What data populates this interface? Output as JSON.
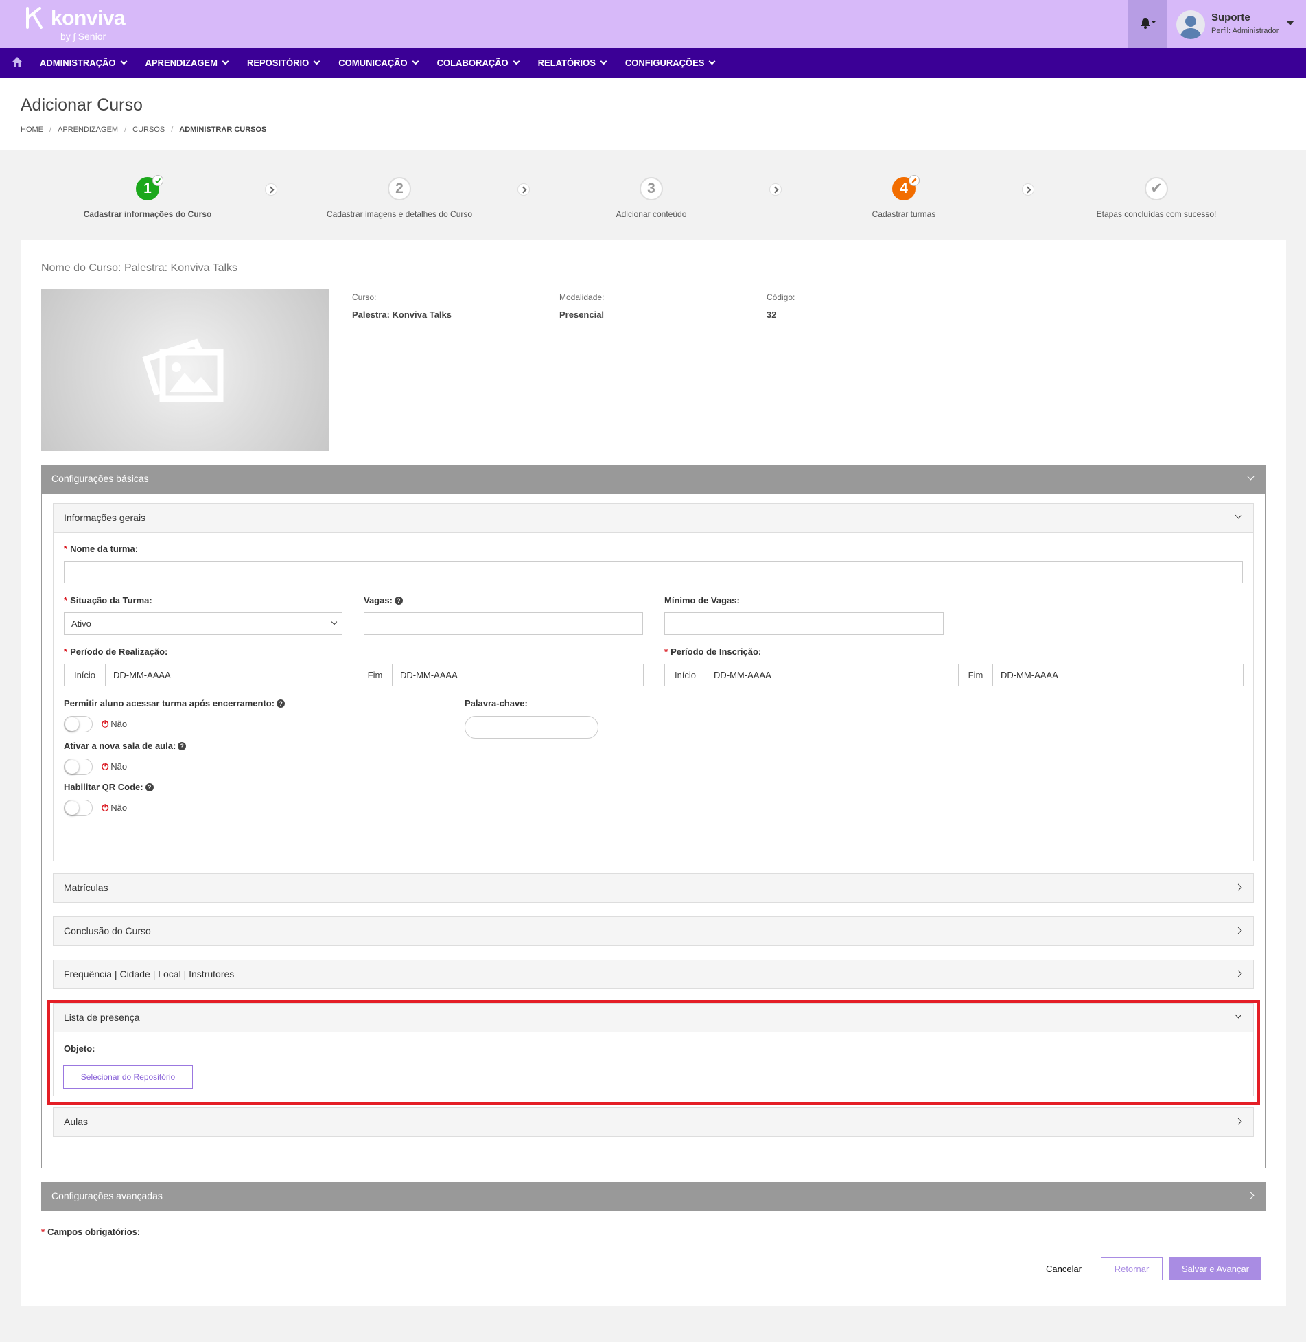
{
  "brand": {
    "logo_text": "konviva",
    "by_text": "by ʃ Senior"
  },
  "user": {
    "name": "Suporte",
    "role": "Perfil: Administrador"
  },
  "nav": {
    "items": [
      "ADMINISTRAÇÃO",
      "APRENDIZAGEM",
      "REPOSITÓRIO",
      "COMUNICAÇÃO",
      "COLABORAÇÃO",
      "RELATÓRIOS",
      "CONFIGURAÇÕES"
    ]
  },
  "page": {
    "title": "Adicionar Curso",
    "breadcrumb": [
      "HOME",
      "APRENDIZAGEM",
      "CURSOS",
      "ADMINISTRAR CURSOS"
    ]
  },
  "steps": [
    {
      "number": "1",
      "label": "Cadastrar informações do Curso",
      "state": "done"
    },
    {
      "number": "2",
      "label": "Cadastrar imagens e detalhes do Curso",
      "state": "pending"
    },
    {
      "number": "3",
      "label": "Adicionar conteúdo",
      "state": "pending"
    },
    {
      "number": "4",
      "label": "Cadastrar turmas",
      "state": "active"
    },
    {
      "number": "✔",
      "label": "Etapas concluídas com sucesso!",
      "state": "final"
    }
  ],
  "course": {
    "name_line": "Nome do Curso: Palestra: Konviva Talks",
    "curso_label": "Curso:",
    "curso_value": "Palestra: Konviva Talks",
    "modalidade_label": "Modalidade:",
    "modalidade_value": "Presencial",
    "codigo_label": "Código:",
    "codigo_value": "32"
  },
  "sections": {
    "basic": "Configurações básicas",
    "general": "Informações gerais",
    "matriculas": "Matrículas",
    "conclusao": "Conclusão do Curso",
    "frequencia": "Frequência | Cidade | Local | Instrutores",
    "presenca": "Lista de presença",
    "aulas": "Aulas",
    "advanced": "Configurações avançadas"
  },
  "form": {
    "required_mark": "*",
    "help_mark": "?",
    "nome_turma_label": "Nome da turma:",
    "situacao_label": "Situação da Turma:",
    "situacao_value": "Ativo",
    "vagas_label": "Vagas:",
    "minimo_label": "Mínimo de Vagas:",
    "realizacao_label": "Período de Realização:",
    "inscricao_label": "Período de Inscrição:",
    "inicio": "Início",
    "fim": "Fim",
    "date_placeholder": "DD-MM-AAAA",
    "permitir_label": "Permitir aluno acessar turma após encerramento:",
    "palavra_label": "Palavra-chave:",
    "nova_sala_label": "Ativar a nova sala de aula:",
    "qr_label": "Habilitar QR Code:",
    "power_glyph": "⏻",
    "nao": "Não",
    "objeto_label": "Objeto:",
    "repo_button": "Selecionar do Repositório"
  },
  "footer": {
    "required_note": "Campos obrigatórios:",
    "cancel": "Cancelar",
    "return": "Retornar",
    "save": "Salvar e Avançar"
  },
  "colors": {
    "header": "#d7b9f9",
    "navbar": "#3b0096",
    "step_done": "#1ca81c",
    "step_active": "#f26d00",
    "accent": "#a98ce3",
    "highlight": "#e41e26"
  },
  "icons": [
    "konviva-logo-icon",
    "bell-icon",
    "avatar-icon",
    "home-icon",
    "image-placeholder-icon",
    "help-icon",
    "power-icon",
    "check-icon",
    "pencil-icon"
  ]
}
